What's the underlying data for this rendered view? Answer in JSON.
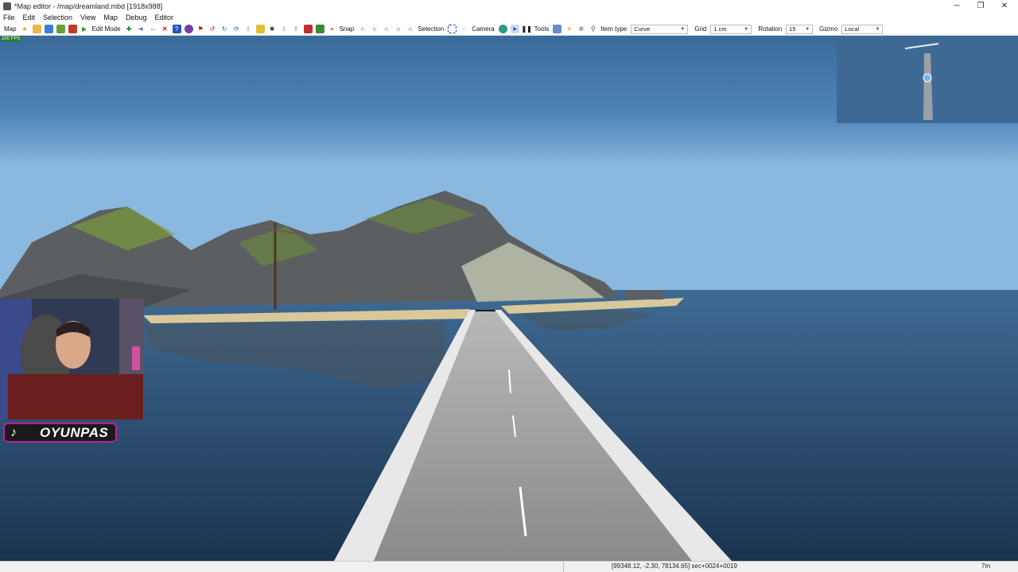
{
  "window": {
    "title": "*Map editor - /map/dreamland.mbd [1918x988]"
  },
  "menu": [
    "File",
    "Edit",
    "Selection",
    "View",
    "Map",
    "Debug",
    "Editor"
  ],
  "toolbar": {
    "map_label": "Map",
    "edit_mode_label": "Edit Mode",
    "snap_label": "Snap",
    "selection_label": "Selection",
    "camera_label": "Camera",
    "tools_label": "Tools",
    "item_type_label": "Item type",
    "item_type_value": "Curve",
    "grid_label": "Grid",
    "grid_value": "1 cm",
    "rotation_label": "Rotation",
    "rotation_value": "15",
    "gizmo_label": "Gizmo",
    "gizmo_value": "Local"
  },
  "viewport": {
    "fps": "200 FPS"
  },
  "status": {
    "coords": "[99348.12, -2.30, 78134.65] sec+0024+0019",
    "time": "7m"
  },
  "overlay": {
    "brand": "OYUNPAS",
    "tiktok_glyph": "♪"
  },
  "colors": {
    "sky_top": "#3a6a9a",
    "sky_horizon": "#8ab8de",
    "water": "#2a4a6a",
    "badge_border": "#c01aa0"
  }
}
